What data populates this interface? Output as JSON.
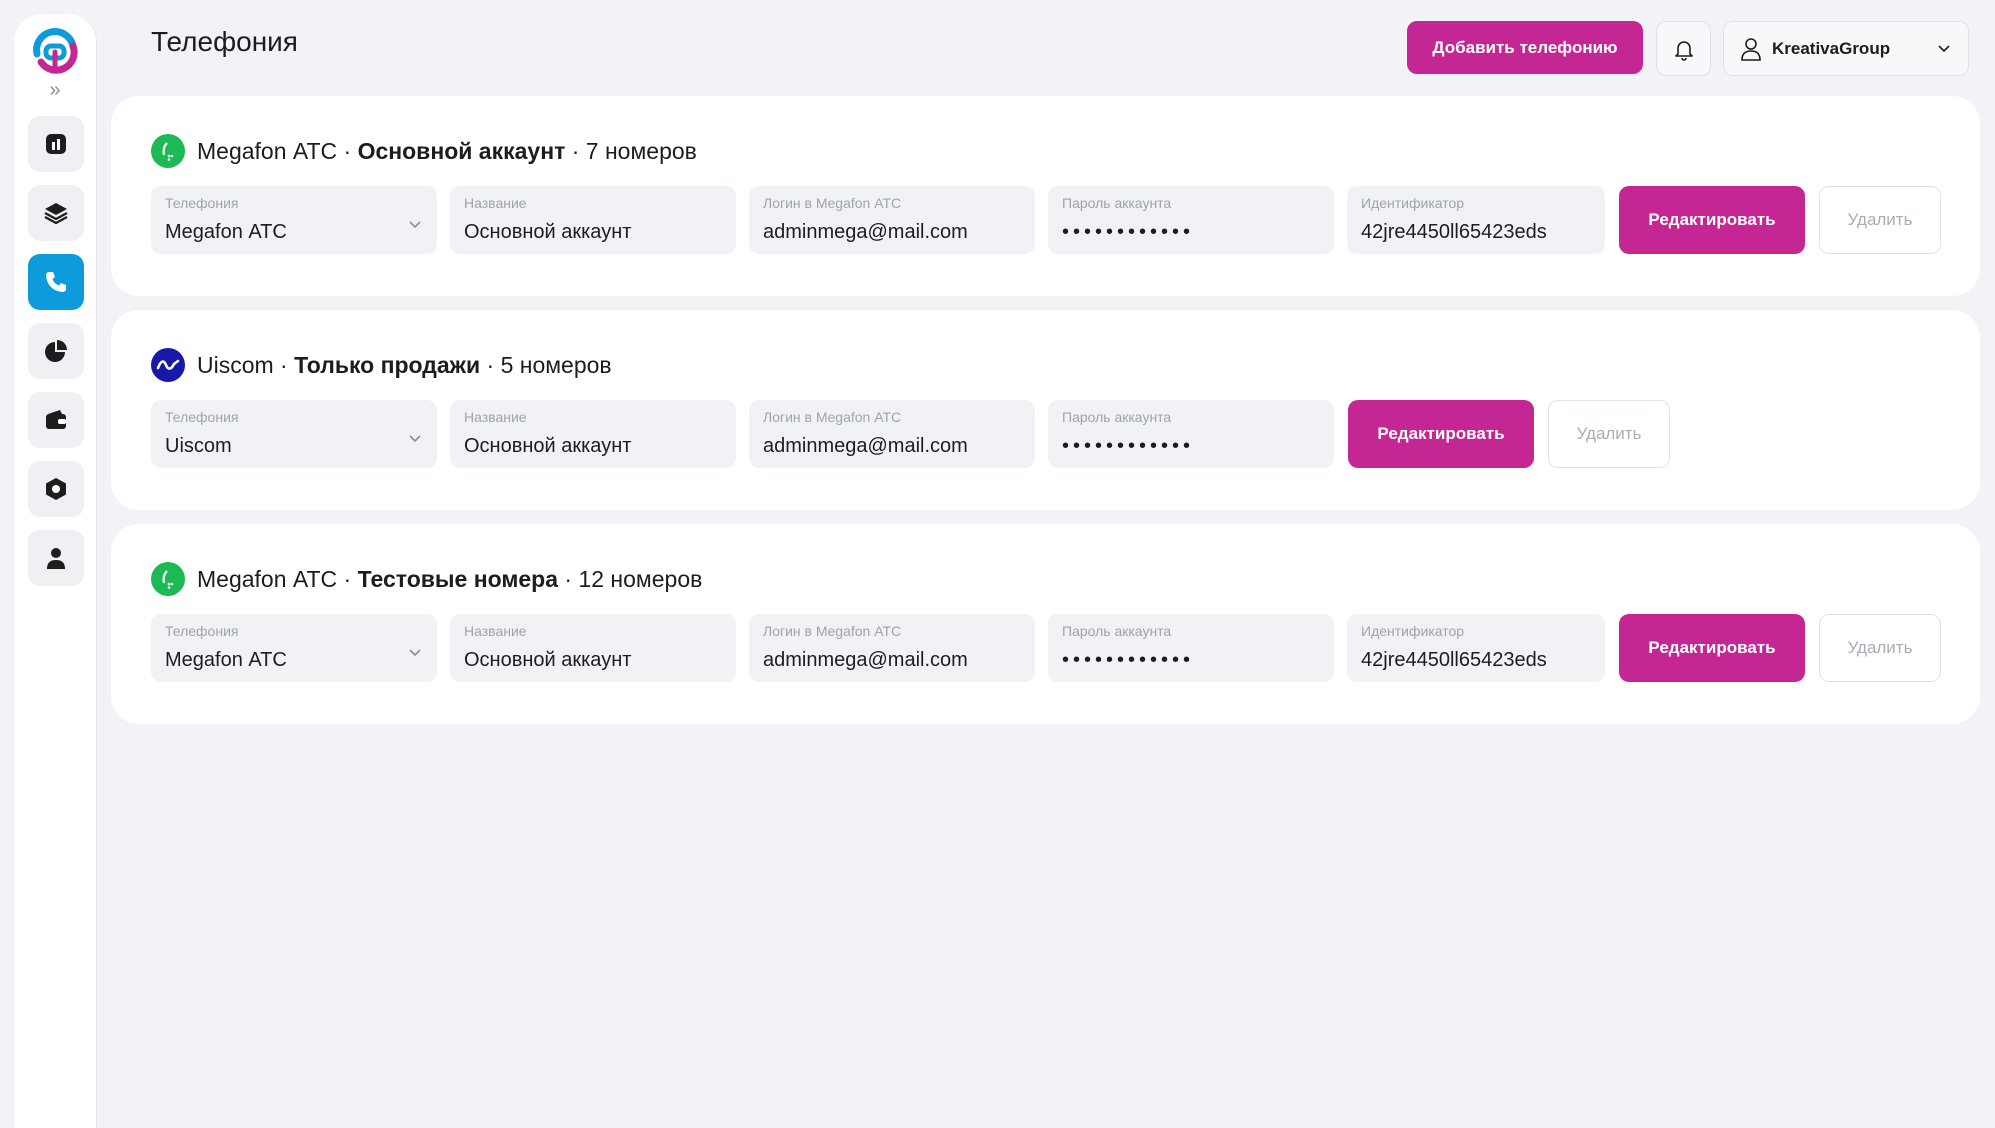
{
  "header": {
    "title": "Телефония",
    "add_button": "Добавить телефонию",
    "account_name": "KreativaGroup"
  },
  "sidebar": {
    "expand_label": "»",
    "items": [
      {
        "icon": "dashboard-icon",
        "active": false
      },
      {
        "icon": "layers-icon",
        "active": false
      },
      {
        "icon": "phone-icon",
        "active": true
      },
      {
        "icon": "pie-chart-icon",
        "active": false
      },
      {
        "icon": "wallet-icon",
        "active": false
      },
      {
        "icon": "hexagon-settings-icon",
        "active": false
      },
      {
        "icon": "user-icon",
        "active": false
      }
    ]
  },
  "colors": {
    "accent": "#c42794",
    "nav_active": "#0d9bdc",
    "megafon": "#1db954",
    "uiscom": "#1818a8"
  },
  "cards": [
    {
      "provider": "Megafon АТС",
      "account_title": "Основной аккаунт",
      "numbers": "· 7 номеров",
      "fields": {
        "telephony_label": "Телефония",
        "telephony_value": "Megafon АТС",
        "name_label": "Название",
        "name_value": "Основной аккаунт",
        "login_label": "Логин в Megafon АТС",
        "login_value": "adminmega@mail.com",
        "password_label": "Пароль аккаунта",
        "password_value": "••••••••••••",
        "id_label": "Идентификатор",
        "id_value": "42jre4450ll65423eds"
      },
      "edit": "Редактировать",
      "delete": "Удалить"
    },
    {
      "provider": "Uiscom",
      "account_title": "Только продажи",
      "numbers": "· 5 номеров",
      "fields": {
        "telephony_label": "Телефония",
        "telephony_value": "Uiscom",
        "name_label": "Название",
        "name_value": "Основной аккаунт",
        "login_label": "Логин в Megafon АТС",
        "login_value": "adminmega@mail.com",
        "password_label": "Пароль аккаунта",
        "password_value": "••••••••••••"
      },
      "edit": "Редактировать",
      "delete": "Удалить"
    },
    {
      "provider": "Megafon АТС",
      "account_title": "Тестовые номера",
      "numbers": "· 12 номеров",
      "fields": {
        "telephony_label": "Телефония",
        "telephony_value": "Megafon АТС",
        "name_label": "Название",
        "name_value": "Основной аккаунт",
        "login_label": "Логин в Megafon АТС",
        "login_value": "adminmega@mail.com",
        "password_label": "Пароль аккаунта",
        "password_value": "••••••••••••",
        "id_label": "Идентификатор",
        "id_value": "42jre4450ll65423eds"
      },
      "edit": "Редактировать",
      "delete": "Удалить"
    }
  ]
}
